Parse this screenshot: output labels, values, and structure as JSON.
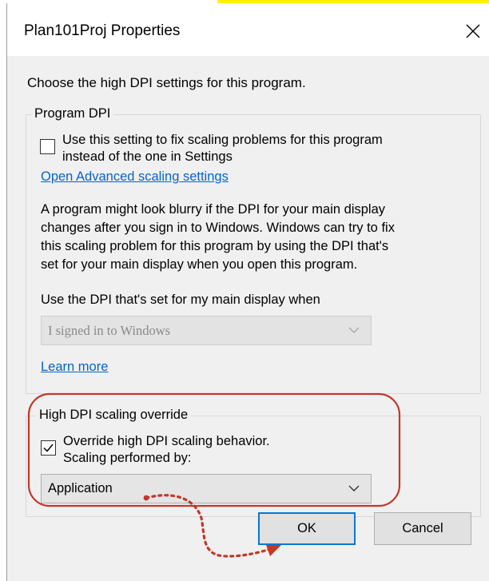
{
  "window": {
    "title": "Plan101Proj Properties"
  },
  "intro": "Choose the high DPI settings for this program.",
  "program_dpi": {
    "legend": "Program DPI",
    "checkbox_line1": "Use this setting to fix scaling problems for this program",
    "checkbox_line2": "instead of the one in Settings",
    "checkbox_checked": false,
    "advanced_link": "Open Advanced scaling settings",
    "para_lines": [
      "A program might look blurry if the DPI for your main display",
      "changes after you sign in to Windows. Windows can try to fix",
      "this scaling problem for this program by using the DPI that's",
      "set for your main display when you open this program."
    ],
    "when_label": "Use the DPI that's set for my main display when",
    "when_select_value": "I signed in to Windows",
    "when_select_disabled": true,
    "learn_more": "Learn more"
  },
  "override": {
    "legend": "High DPI scaling override",
    "checkbox_line1": "Override high DPI scaling behavior.",
    "checkbox_line2": "Scaling performed by:",
    "checkbox_checked": true,
    "select_value": "Application"
  },
  "buttons": {
    "ok": "OK",
    "cancel": "Cancel"
  },
  "colors": {
    "dialog_bg": "#f0f0f0",
    "link": "#0066cc",
    "annotation_red": "#c0392b",
    "top_highlight": "#fff200"
  }
}
